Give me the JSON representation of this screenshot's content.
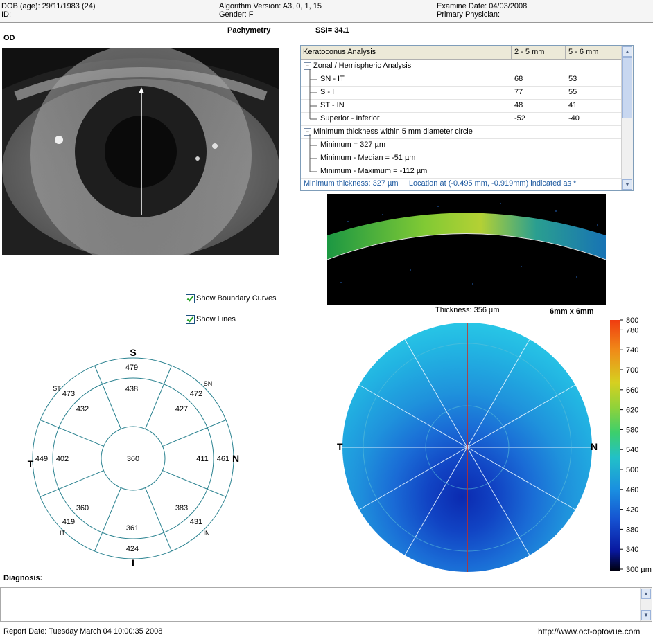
{
  "header": {
    "dob": "DOB (age): 29/11/1983 (24)",
    "id": "ID:",
    "algorithm": "Algorithm Version: A3, 0, 1, 15",
    "gender": "Gender: F",
    "examine_date": "Examine Date: 04/03/2008",
    "physician": "Primary Physician:"
  },
  "eye_label": "OD",
  "title": "Pachymetry",
  "ssi": "SSI= 34.1",
  "kera": {
    "header": [
      "Keratoconus Analysis",
      "2 - 5 mm",
      "5 - 6 mm"
    ],
    "group1": "Zonal / Hemispheric Analysis",
    "rows": [
      {
        "label": "SN - IT",
        "v1": "68",
        "v2": "53"
      },
      {
        "label": "S - I",
        "v1": "77",
        "v2": "55"
      },
      {
        "label": "ST - IN",
        "v1": "48",
        "v2": "41"
      },
      {
        "label": "Superior - Inferior",
        "v1": "-52",
        "v2": "-40"
      }
    ],
    "group2": "Minimum thickness within 5 mm diameter circle",
    "rows2": [
      "Minimum = 327 µm",
      "Minimum - Median = -51 µm",
      "Minimum - Maximum = -112 µm"
    ],
    "footer": "Minimum thickness: 327 µm     Location at (-0.495 mm, -0.919mm) indicated as *"
  },
  "checkboxes": {
    "curves": "Show Boundary Curves",
    "lines": "Show Lines",
    "curves_checked": true,
    "lines_checked": true
  },
  "thickness_label": "Thickness: 356 µm",
  "scan_size": "6mm x 6mm",
  "sector": {
    "dirs": {
      "S": "S",
      "I": "I",
      "T": "T",
      "N": "N",
      "SN": "SN",
      "ST": "ST",
      "IT": "IT",
      "IN": "IN"
    },
    "center": "360",
    "inner": {
      "s": "438",
      "sn": "427",
      "n": "411",
      "in": "383",
      "i": "361",
      "it": "360",
      "t": "402",
      "st": "432"
    },
    "outer": {
      "s": "479",
      "sn": "472",
      "n": "461",
      "in": "431",
      "i": "424",
      "it": "419",
      "t": "449",
      "st": "473"
    }
  },
  "map_labels": {
    "T": "T",
    "N": "N"
  },
  "colorbar": {
    "ticks": [
      "800",
      "780",
      "740",
      "700",
      "660",
      "620",
      "580",
      "540",
      "500",
      "460",
      "420",
      "380",
      "340",
      "300 µm"
    ]
  },
  "diagnosis_label": "Diagnosis:",
  "footer": {
    "report_date": "Report Date: Tuesday March 04 10:00:35 2008",
    "url": "http://www.oct-optovue.com"
  }
}
